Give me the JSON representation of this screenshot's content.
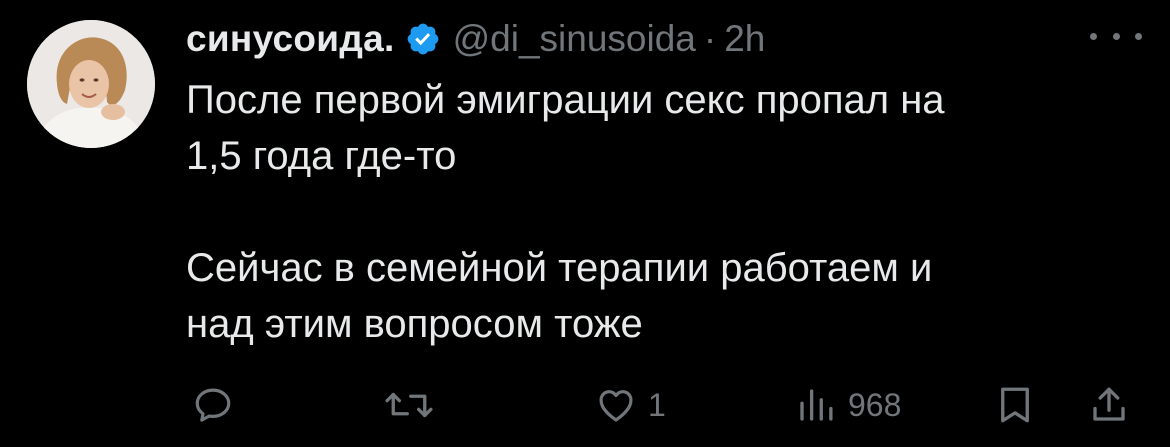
{
  "tweet": {
    "author": {
      "display_name": "синусоида.",
      "handle": "@di_sinusoida",
      "separator": "·",
      "time": "2h",
      "verified_icon": "verified-badge-icon",
      "verified_color": "#1d9bf0"
    },
    "text": {
      "line1": "После первой эмиграции секс пропал на",
      "line2": "1,5 года где-то",
      "line3": "Сейчас в семейной терапии работаем и",
      "line4": "над этим вопросом тоже"
    },
    "more_icon": "more-horizontal-icon",
    "actions": {
      "reply": {
        "icon": "reply-icon"
      },
      "retweet": {
        "icon": "retweet-icon"
      },
      "like": {
        "icon": "heart-icon",
        "count": "1"
      },
      "views": {
        "icon": "views-chart-icon",
        "count": "968"
      },
      "bookmark": {
        "icon": "bookmark-icon"
      },
      "share": {
        "icon": "share-icon"
      }
    }
  },
  "colors": {
    "background": "#000000",
    "text_primary": "#e7e9ea",
    "text_secondary": "#71767b",
    "accent": "#1d9bf0"
  }
}
